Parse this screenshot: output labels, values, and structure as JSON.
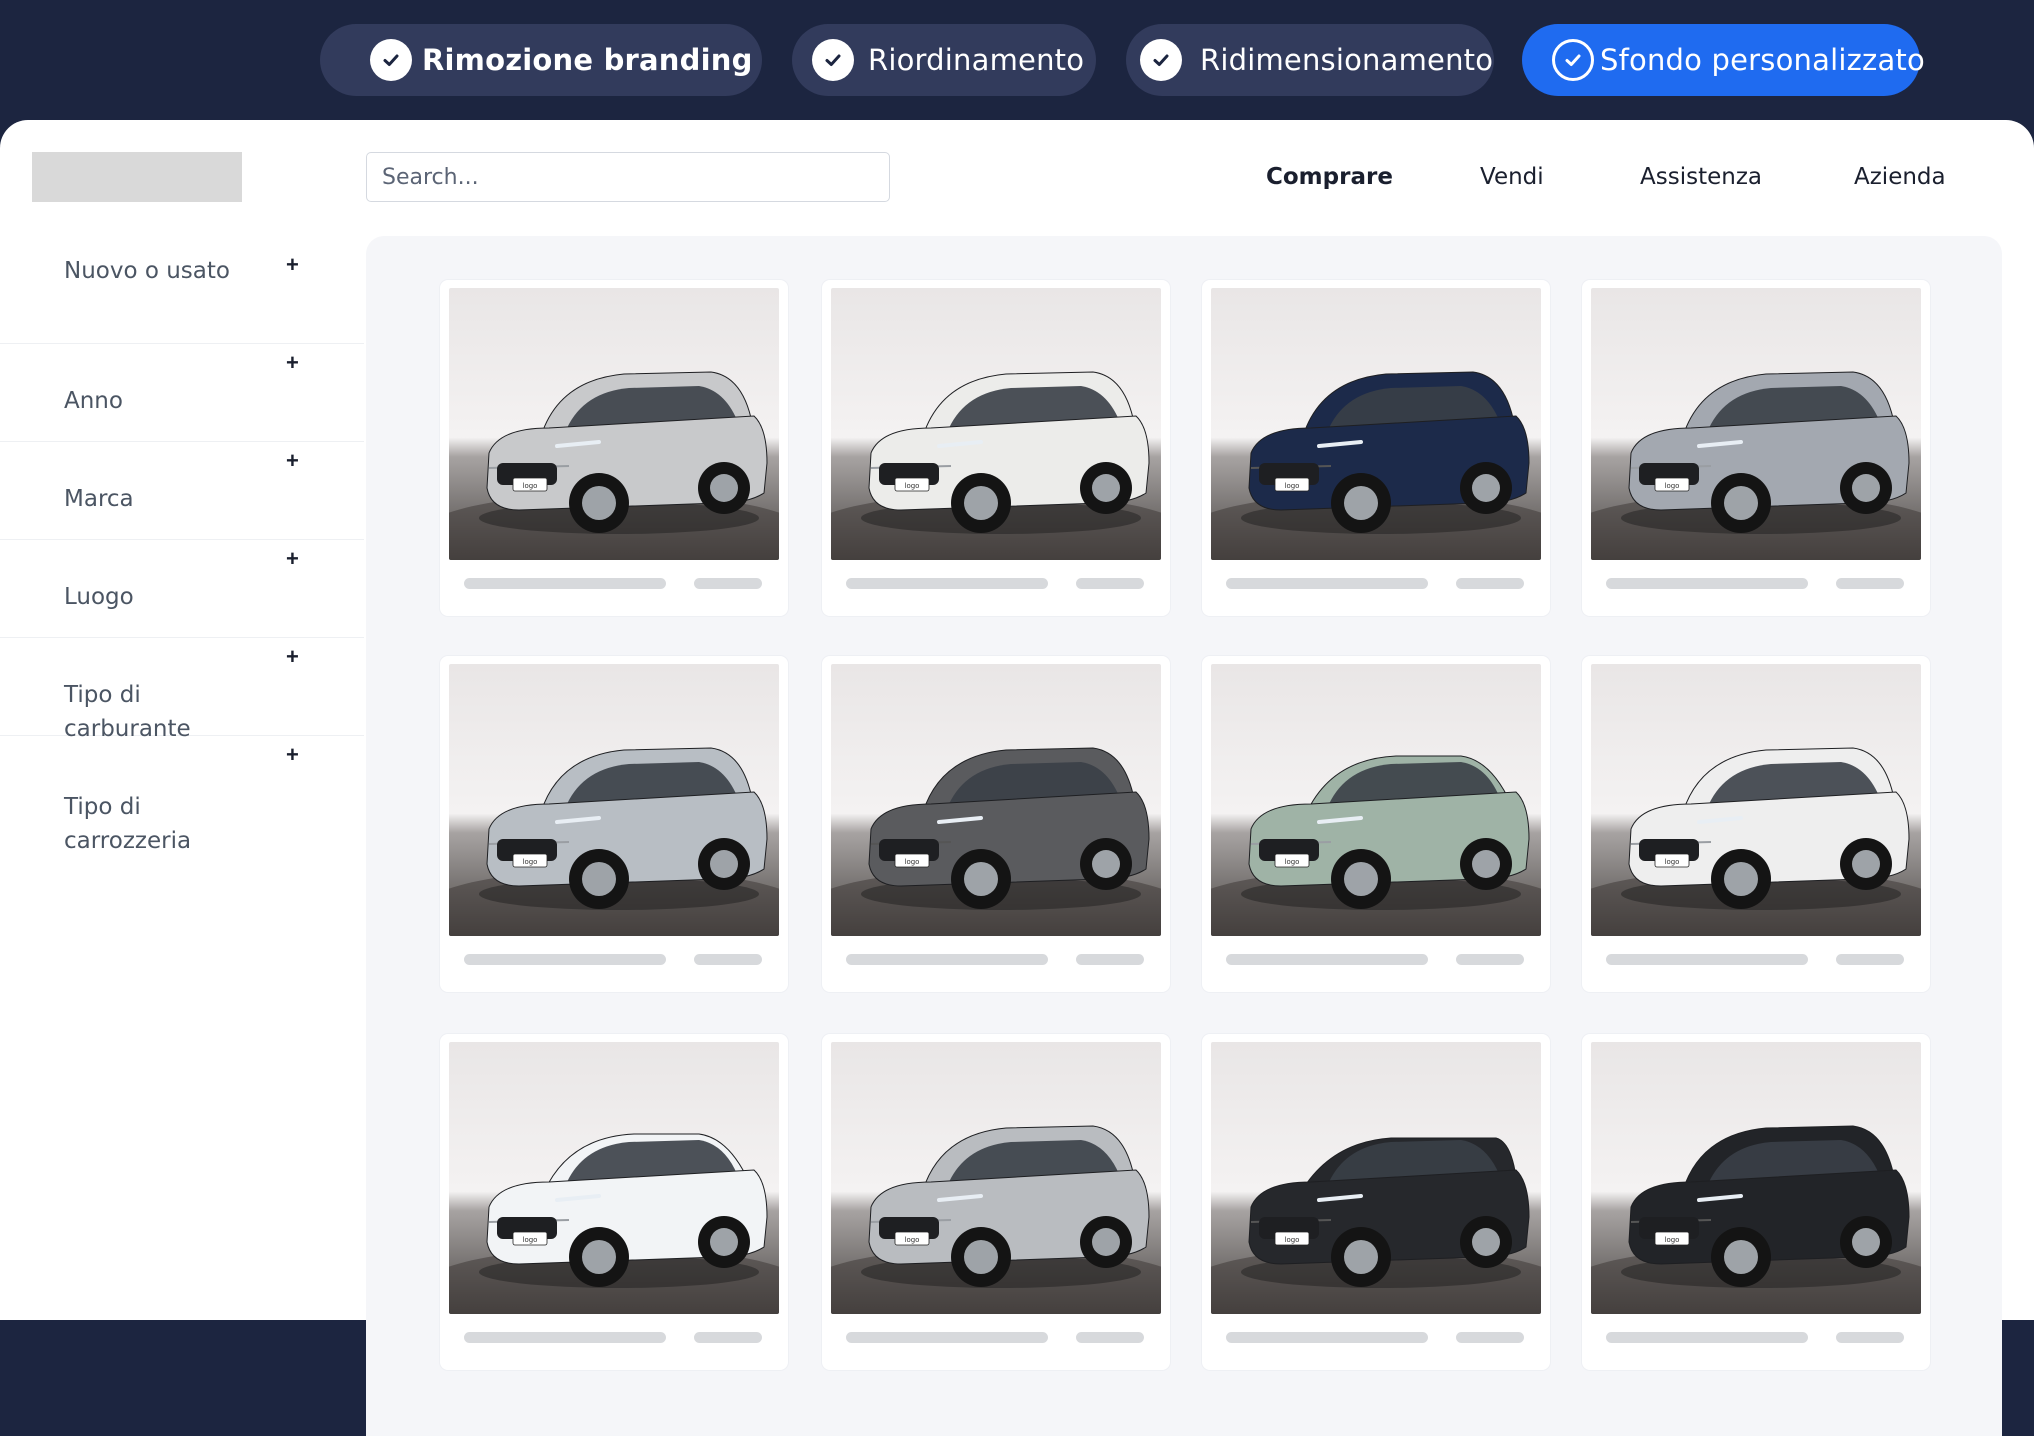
{
  "toolbar": {
    "pills": [
      {
        "label": "Rimozione branding",
        "icon": "check-icon"
      },
      {
        "label": "Riordinamento",
        "icon": "check-icon"
      },
      {
        "label": "Ridimensionamento",
        "icon": "check-icon"
      },
      {
        "label": "Sfondo personalizzato",
        "icon": "check-circle-icon",
        "active": true
      }
    ]
  },
  "header": {
    "search_placeholder": "Search...",
    "nav": [
      "Comprare",
      "Vendi",
      "Assistenza",
      "Azienda"
    ]
  },
  "sidebar": {
    "filters": [
      "Nuovo o usato",
      "Anno",
      "Marca",
      "Luogo",
      "Tipo di carburante",
      "Tipo di carrozzeria"
    ]
  },
  "cars": [
    {
      "color": "#c8c9cb",
      "body": "suv",
      "badge": "logo"
    },
    {
      "color": "#ececea",
      "body": "suv",
      "badge": "logo"
    },
    {
      "color": "#1c2a4a",
      "body": "suv",
      "badge": "logo"
    },
    {
      "color": "#a3a8b0",
      "body": "suv",
      "badge": "logo"
    },
    {
      "color": "#b8bec4",
      "body": "suv",
      "badge": "logo"
    },
    {
      "color": "#5a5b5e",
      "body": "suv",
      "badge": "logo"
    },
    {
      "color": "#9fb3a6",
      "body": "hatch",
      "badge": "logo"
    },
    {
      "color": "#eeeeee",
      "body": "suv",
      "badge": "logo"
    },
    {
      "color": "#f2f4f6",
      "body": "hatch",
      "badge": "logo"
    },
    {
      "color": "#b9bcc0",
      "body": "suv",
      "badge": "logo"
    },
    {
      "color": "#26282c",
      "body": "wagon",
      "badge": "logo"
    },
    {
      "color": "#222428",
      "body": "suv",
      "badge": "logo"
    }
  ],
  "colors": {
    "topbar": "#1c2540",
    "pill": "#323b5c",
    "pill_active": "#1f6bf0",
    "grid_bg": "#f5f6f9",
    "skeleton": "#d7d9dc"
  }
}
